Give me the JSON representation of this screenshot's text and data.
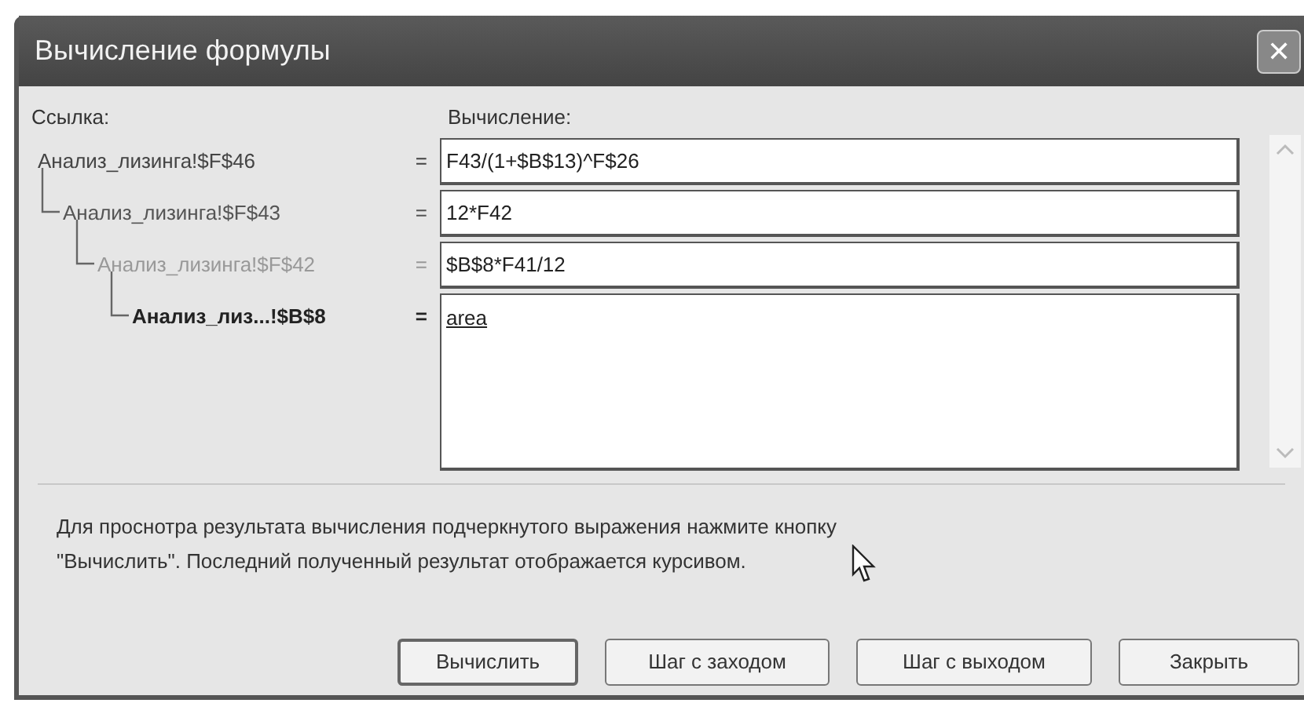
{
  "window": {
    "title": "Вычисление формулы",
    "close": "✕"
  },
  "labels": {
    "reference": "Ссылка:",
    "evaluation": "Вычисление:"
  },
  "tree": [
    {
      "reference": "Анализ_лизинга!$F$46",
      "equals": "=",
      "value": "F43/(1+$B$13)^F$26",
      "selected": false,
      "children": [
        {
          "reference": "Анализ_лизинга!$F$43",
          "equals": "=",
          "value": "12*F42",
          "selected": false,
          "children": [
            {
              "reference": "Анализ_лизинга!$F$42",
              "equals": "=",
              "value": "$B$8*F41/12",
              "selected": false,
              "children": [
                {
                  "reference": "Анализ_лиз...!$B$8",
                  "equals": "=",
                  "value": "area",
                  "selected": true
                }
              ]
            }
          ]
        }
      ]
    }
  ],
  "hint": "Для проснотра результата вычисления подчеркнутого выражения нажмите кнопку \"Вычислить\".  Последний полученный результат отображается курсивом.",
  "buttons": [
    {
      "label": "Вычислить",
      "default": true
    },
    {
      "label": "Шаг с заходом",
      "default": false
    },
    {
      "label": "Шаг с выходом",
      "default": false
    },
    {
      "label": "Закрыть",
      "default": false
    }
  ]
}
